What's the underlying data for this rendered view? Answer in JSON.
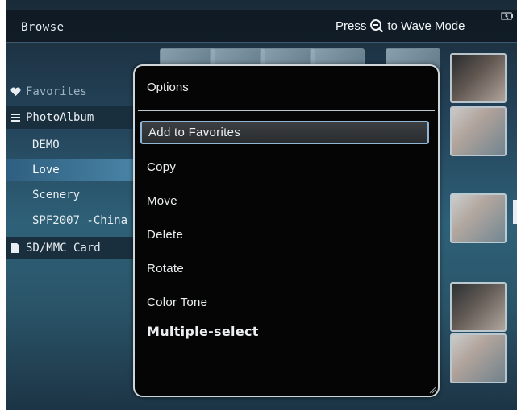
{
  "header": {
    "title": "Browse",
    "hint_prefix": "Press",
    "hint_suffix": "to Wave Mode"
  },
  "sidebar": {
    "items": [
      {
        "label": "Favorites",
        "icon": "heart-icon"
      },
      {
        "label": "PhotoAlbum",
        "icon": "list-icon"
      },
      {
        "label": "DEMO"
      },
      {
        "label": "Love"
      },
      {
        "label": "Scenery"
      },
      {
        "label": "SPF2007 -China"
      },
      {
        "label": "SD/MMC Card",
        "icon": "sd-card-icon"
      }
    ],
    "selected_index": 3
  },
  "dialog": {
    "title": "Options",
    "options": [
      "Add to Favorites",
      "Copy",
      "Move",
      "Delete",
      "Rotate",
      "Color Tone",
      "Multiple-select"
    ],
    "selected_index": 0
  },
  "colors": {
    "selection_border": "#8fb6d6",
    "sidebar_selected": "#4a86a8",
    "dialog_bg": "#050505"
  }
}
